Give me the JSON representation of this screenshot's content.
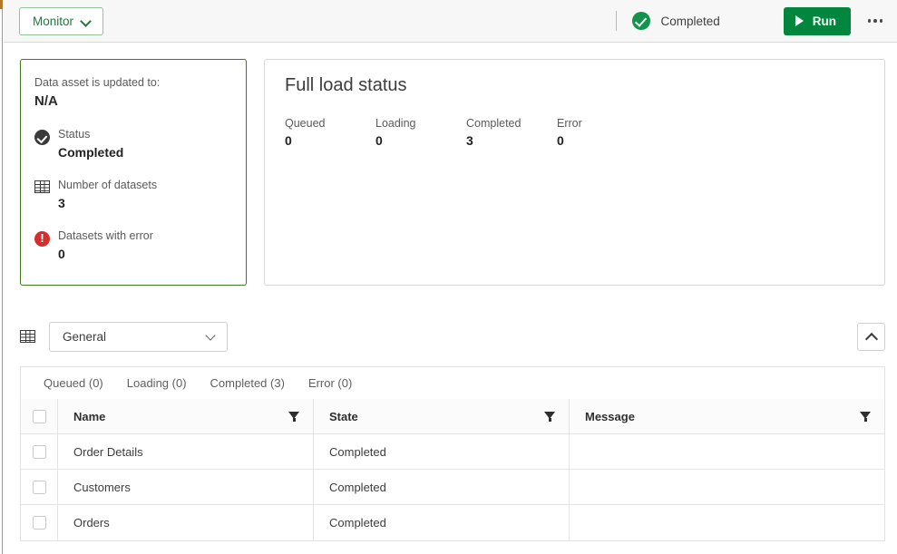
{
  "topbar": {
    "monitor_label": "Monitor",
    "monitor_chevron_icon": "chevron-down-icon",
    "status_icon": "check-circle-icon",
    "status_text": "Completed",
    "run_label": "Run",
    "run_icon": "play-icon",
    "overflow_icon": "kebab-menu-icon",
    "run_color": "#00873d",
    "status_color": "#12924b"
  },
  "summary_card": {
    "updated_label": "Data asset is updated to:",
    "updated_value": "N/A",
    "border_color": "#3f7a1e",
    "rows": [
      {
        "icon": "check-circle-icon",
        "label": "Status",
        "value": "Completed"
      },
      {
        "icon": "grid-table-icon",
        "label": "Number of datasets",
        "value": "3"
      },
      {
        "icon": "error-circle-icon",
        "label": "Datasets with error",
        "value": "0"
      }
    ]
  },
  "load_status": {
    "title": "Full load status",
    "stats": [
      {
        "label": "Queued",
        "value": "0"
      },
      {
        "label": "Loading",
        "value": "0"
      },
      {
        "label": "Completed",
        "value": "3"
      },
      {
        "label": "Error",
        "value": "0"
      }
    ]
  },
  "toolbar": {
    "grid_icon": "grid-table-icon",
    "select_value": "General",
    "select_chevron_icon": "chevron-down-icon",
    "collapse_icon": "chevron-up-icon"
  },
  "tabs": [
    {
      "label": "Queued (0)"
    },
    {
      "label": "Loading (0)"
    },
    {
      "label": "Completed (3)"
    },
    {
      "label": "Error (0)"
    }
  ],
  "table": {
    "columns": [
      {
        "label": "Name",
        "filter_icon": "filter-funnel-icon"
      },
      {
        "label": "State",
        "filter_icon": "filter-funnel-icon"
      },
      {
        "label": "Message",
        "filter_icon": "filter-funnel-icon"
      }
    ],
    "rows": [
      {
        "name": "Order Details",
        "state": "Completed",
        "message": ""
      },
      {
        "name": "Customers",
        "state": "Completed",
        "message": ""
      },
      {
        "name": "Orders",
        "state": "Completed",
        "message": ""
      }
    ]
  }
}
